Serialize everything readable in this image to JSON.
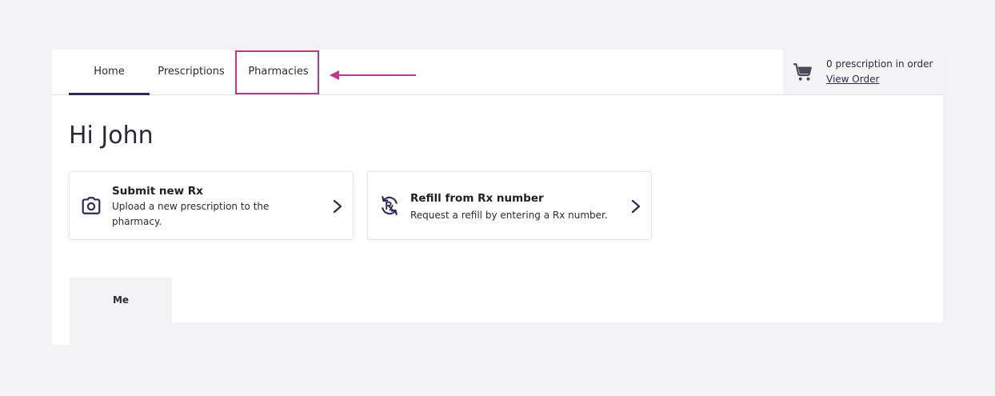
{
  "nav": {
    "tabs": [
      {
        "label": "Home",
        "active": true
      },
      {
        "label": "Prescriptions",
        "active": false
      },
      {
        "label": "Pharmacies",
        "active": false,
        "highlighted": true
      }
    ]
  },
  "cart": {
    "count_text": "0 prescription in order",
    "link_label": "View Order",
    "icon": "cart-icon"
  },
  "greeting": "Hi John",
  "cards": [
    {
      "title": "Submit new Rx",
      "description": "Upload a new prescription to the pharmacy.",
      "icon": "camera-icon"
    },
    {
      "title": "Refill from Rx number",
      "description": "Request a refill by entering a Rx number.",
      "icon": "rx-refill-icon"
    }
  ],
  "bottom_tab": {
    "label": "Me"
  },
  "colors": {
    "accent": "#2d2a56",
    "highlight": "#c0378a",
    "background": "#f3f3f5"
  }
}
